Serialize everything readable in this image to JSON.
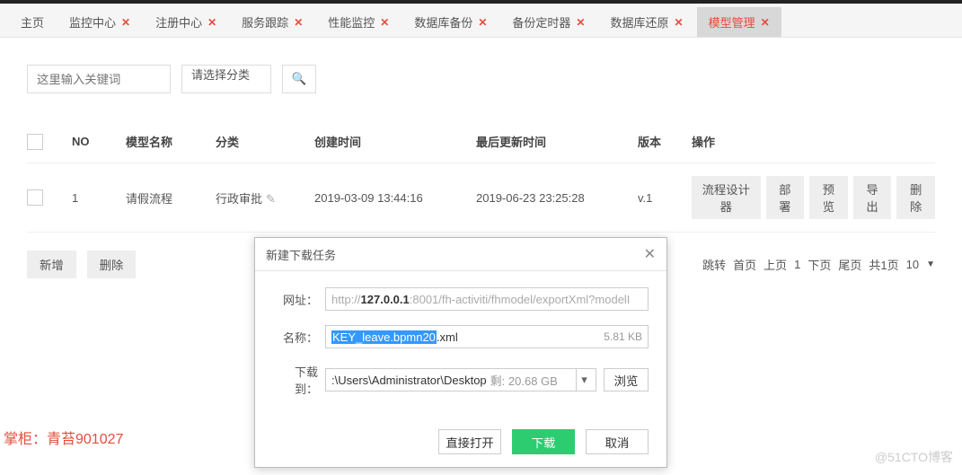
{
  "tabs": [
    {
      "label": "主页",
      "closable": false
    },
    {
      "label": "监控中心",
      "closable": true
    },
    {
      "label": "注册中心",
      "closable": true
    },
    {
      "label": "服务跟踪",
      "closable": true
    },
    {
      "label": "性能监控",
      "closable": true
    },
    {
      "label": "数据库备份",
      "closable": true
    },
    {
      "label": "备份定时器",
      "closable": true
    },
    {
      "label": "数据库还原",
      "closable": true
    },
    {
      "label": "模型管理",
      "closable": true,
      "active": true
    }
  ],
  "filter": {
    "keyword_placeholder": "这里输入关键词",
    "category_placeholder": "请选择分类"
  },
  "table": {
    "headers": {
      "no": "NO",
      "name": "模型名称",
      "category": "分类",
      "created": "创建时间",
      "updated": "最后更新时间",
      "version": "版本",
      "ops": "操作"
    },
    "rows": [
      {
        "no": "1",
        "name": "请假流程",
        "category": "行政审批",
        "created": "2019-03-09 13:44:16",
        "updated": "2019-06-23 23:25:28",
        "version": "v.1"
      }
    ],
    "op_labels": {
      "design": "流程设计器",
      "deploy": "部署",
      "preview": "预览",
      "export": "导出",
      "delete": "删除"
    }
  },
  "footer": {
    "add": "新增",
    "delete": "删除",
    "pagination": {
      "jump": "跳转",
      "first": "首页",
      "prev": "上页",
      "current": "1",
      "next": "下页",
      "last": "尾页",
      "total": "共1页",
      "size": "10"
    }
  },
  "dialog": {
    "title": "新建下载任务",
    "url_label": "网址：",
    "url_prefix": "http://",
    "url_host": "127.0.0.1",
    "url_port_path": ":8001/fh-activiti/fhmodel/exportXml?modelI",
    "name_label": "名称：",
    "name_selected": "KEY_leave.bpmn20",
    "name_ext": ".xml",
    "size": "5.81 KB",
    "path_label": "下载到：",
    "path_value": ":\\Users\\Administrator\\Desktop",
    "path_avail": "剩: 20.68 GB",
    "browse": "浏览",
    "open_direct": "直接打开",
    "download": "下载",
    "cancel": "取消"
  },
  "watermark": {
    "left": "掌柜：青苔901027",
    "right": "@51CTO博客"
  }
}
